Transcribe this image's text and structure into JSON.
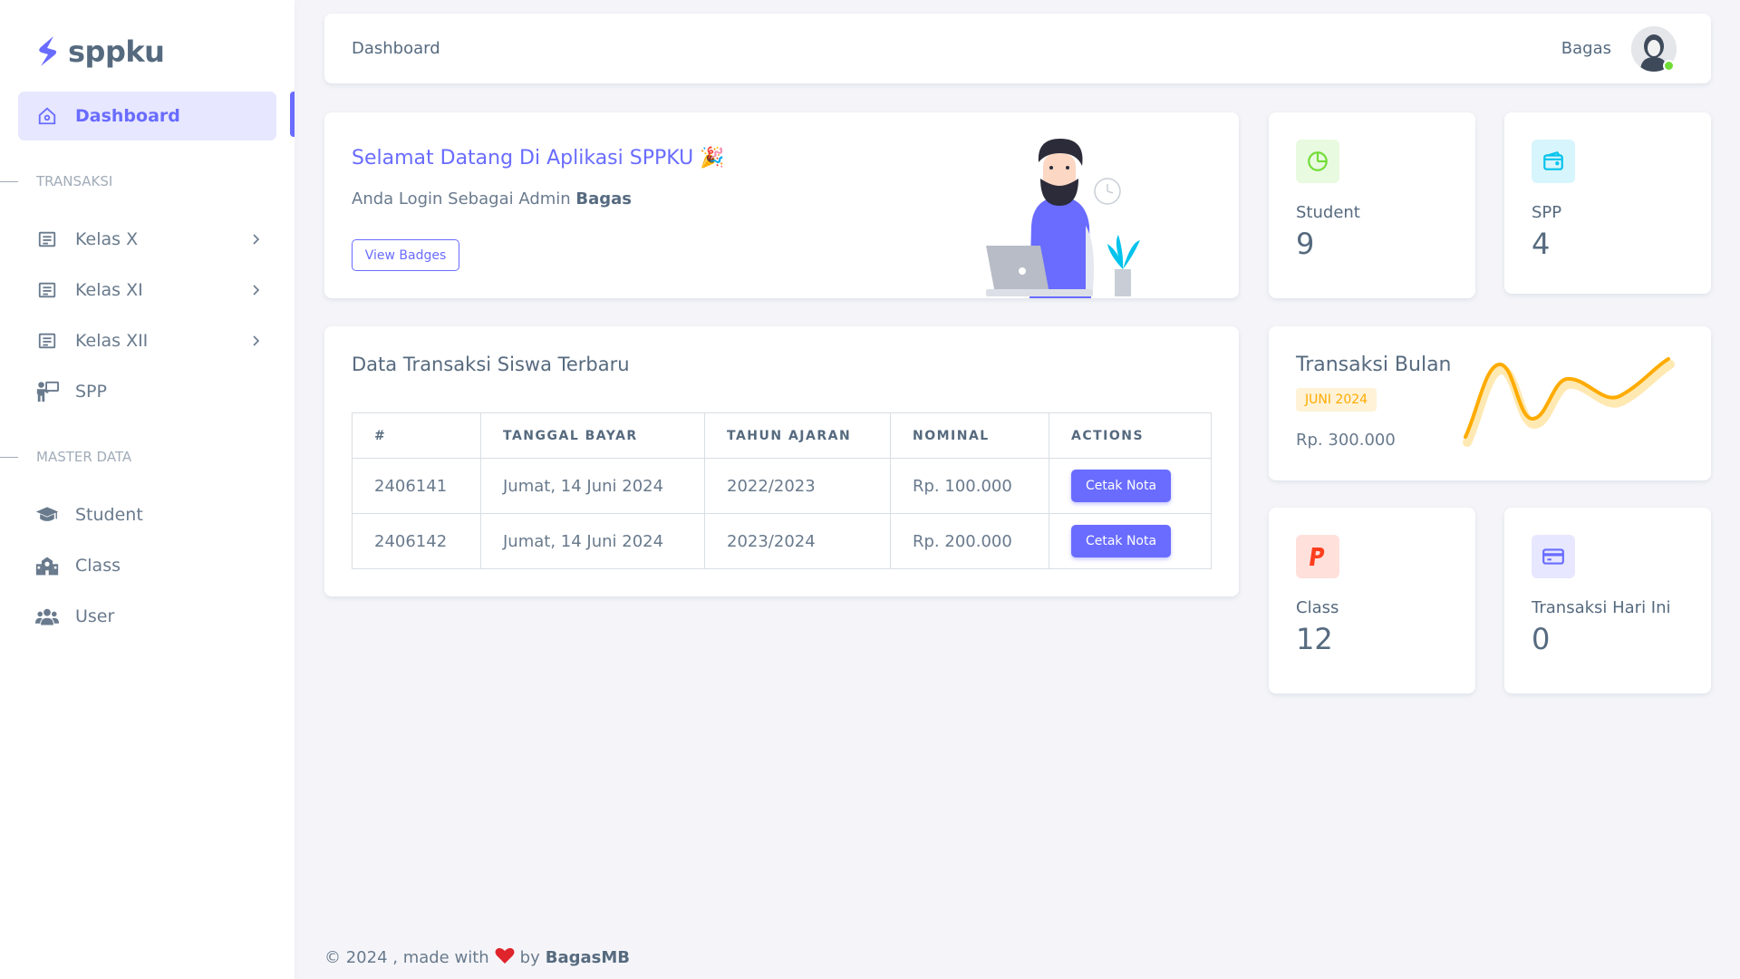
{
  "brand": {
    "name": "sppku"
  },
  "sidebar": {
    "dashboard": "Dashboard",
    "header_transaksi": "TRANSAKSI",
    "header_master": "MASTER DATA",
    "items": [
      {
        "label": "Kelas X"
      },
      {
        "label": "Kelas XI"
      },
      {
        "label": "Kelas XII"
      },
      {
        "label": "SPP"
      },
      {
        "label": "Student"
      },
      {
        "label": "Class"
      },
      {
        "label": "User"
      }
    ]
  },
  "navbar": {
    "title": "Dashboard",
    "user": "Bagas"
  },
  "welcome": {
    "title": "Selamat Datang Di Aplikasi SPPKU 🎉",
    "subtitle_prefix": "Anda Login Sebagai Admin ",
    "subtitle_name": "Bagas",
    "button": "View Badges"
  },
  "stats": {
    "student": {
      "label": "Student",
      "value": "9"
    },
    "spp": {
      "label": "SPP",
      "value": "4"
    },
    "class": {
      "label": "Class",
      "value": "12"
    },
    "today": {
      "label": "Transaksi Hari Ini",
      "value": "0"
    }
  },
  "transaksi": {
    "title": "Transaksi Bulan",
    "badge": "JUNI 2024",
    "amount": "Rp. 300.000"
  },
  "table": {
    "title": "Data Transaksi Siswa Terbaru",
    "headers": [
      "#",
      "TANGGAL BAYAR",
      "TAHUN AJARAN",
      "NOMINAL",
      "ACTIONS"
    ],
    "rows": [
      {
        "id": "2406141",
        "tanggal": "Jumat, 14 Juni 2024",
        "tahun": "2022/2023",
        "nominal": "Rp. 100.000",
        "action": "Cetak Nota"
      },
      {
        "id": "2406142",
        "tanggal": "Jumat, 14 Juni 2024",
        "tahun": "2023/2024",
        "nominal": "Rp. 200.000",
        "action": "Cetak Nota"
      }
    ]
  },
  "footer": {
    "prefix": "© 2024 , made with",
    "by": "by",
    "author": "BagasMB"
  },
  "colors": {
    "primary": "#696cff",
    "warning": "#ffab00",
    "success": "#71dd37",
    "info": "#03c3ec",
    "danger": "#ff3e1d"
  }
}
